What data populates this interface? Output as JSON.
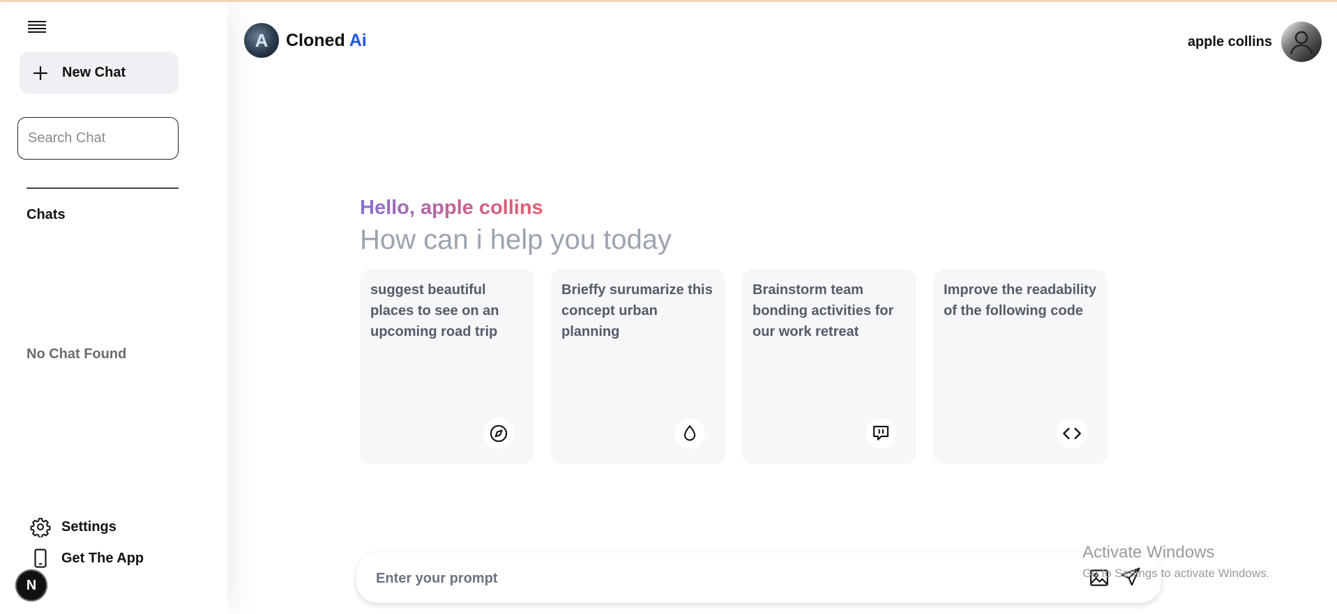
{
  "sidebar": {
    "new_chat_label": "New Chat",
    "search_placeholder": "Search Chat",
    "chats_title": "Chats",
    "empty_text": "No Chat Found",
    "settings_label": "Settings",
    "get_app_label": "Get The App",
    "badge_letter": "N"
  },
  "header": {
    "brand_name": "Cloned",
    "brand_accent": "Ai",
    "logo_letter": "A",
    "user_name": "apple collins"
  },
  "main": {
    "greeting": "Hello, apple collins",
    "subtitle": "How can i help you today",
    "cards": [
      {
        "text": "suggest beautiful places to see on an upcoming road trip",
        "icon": "compass-icon"
      },
      {
        "text": "Brieffy surumarize this concept urban planning",
        "icon": "droplet-icon"
      },
      {
        "text": "Brainstorm team bonding activities for our work retreat",
        "icon": "chat-bubble-icon"
      },
      {
        "text": "Improve the readability of the following code",
        "icon": "code-icon"
      }
    ]
  },
  "prompt": {
    "placeholder": "Enter your prompt",
    "value": ""
  },
  "watermark": {
    "line1": "Activate Windows",
    "line2": "Go to Settings to activate Windows."
  },
  "colors": {
    "brand_accent": "#1f57e0",
    "greeting_start": "#8b6fd6",
    "greeting_end": "#e05d6f",
    "card_bg": "#f6f7f9",
    "new_chat_bg": "#eef0f3"
  }
}
